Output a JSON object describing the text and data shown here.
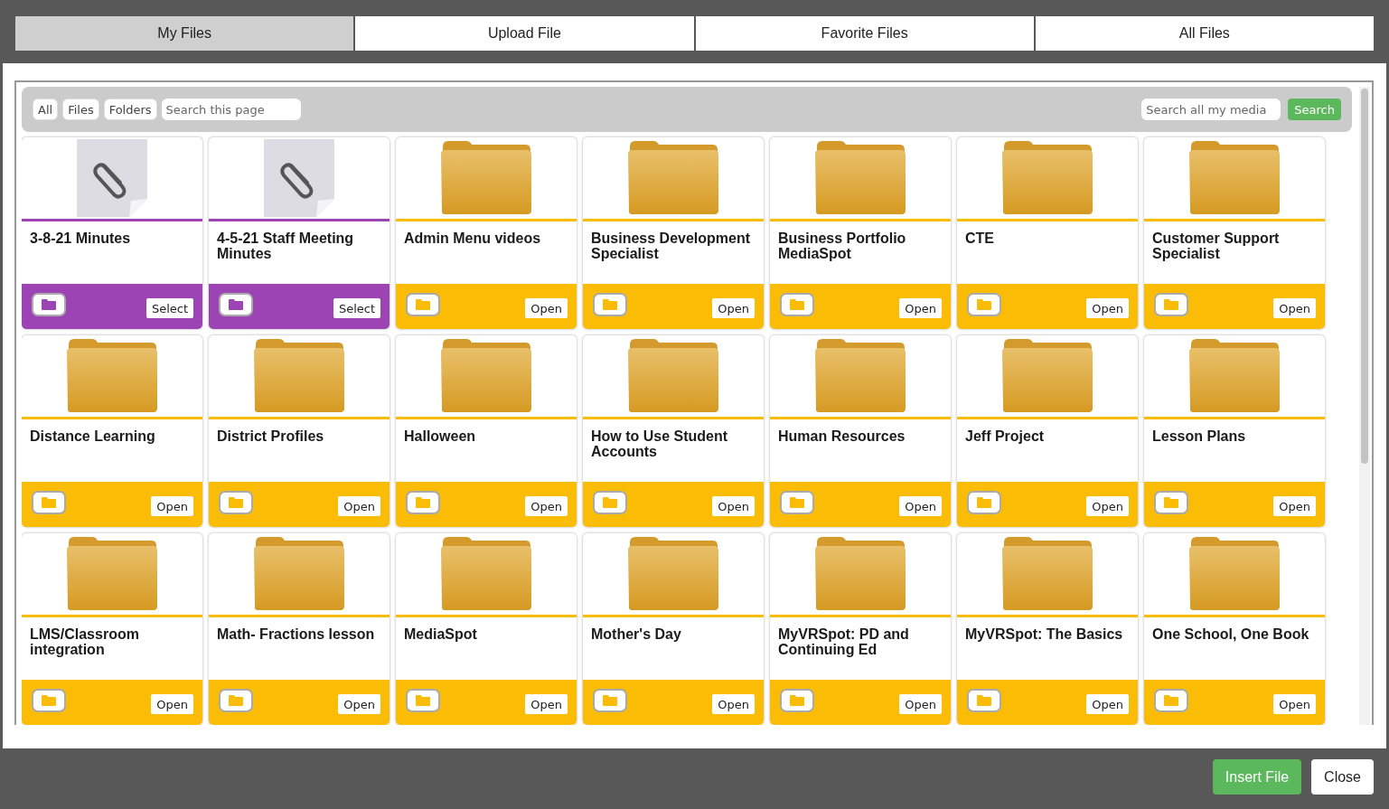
{
  "tabs": [
    {
      "label": "My Files",
      "selected": true
    },
    {
      "label": "Upload File",
      "selected": false
    },
    {
      "label": "Favorite Files",
      "selected": false
    },
    {
      "label": "All Files",
      "selected": false
    }
  ],
  "filters": [
    {
      "label": "All"
    },
    {
      "label": "Files"
    },
    {
      "label": "Folders"
    }
  ],
  "page_search": {
    "placeholder": "Search this page"
  },
  "media_search": {
    "placeholder": "Search all my media",
    "button": "Search"
  },
  "items": [
    {
      "kind": "file",
      "title": "3-8-21 Minutes",
      "action": "Select"
    },
    {
      "kind": "file",
      "title": "4-5-21 Staff Meeting Minutes",
      "action": "Select"
    },
    {
      "kind": "folder",
      "title": "Admin Menu videos",
      "action": "Open"
    },
    {
      "kind": "folder",
      "title": "Business Development Specialist",
      "action": "Open"
    },
    {
      "kind": "folder",
      "title": "Business Portfolio MediaSpot",
      "action": "Open"
    },
    {
      "kind": "folder",
      "title": "CTE",
      "action": "Open"
    },
    {
      "kind": "folder",
      "title": "Customer Support Specialist",
      "action": "Open"
    },
    {
      "kind": "folder",
      "title": "Distance Learning",
      "action": "Open"
    },
    {
      "kind": "folder",
      "title": "District Profiles",
      "action": "Open"
    },
    {
      "kind": "folder",
      "title": "Halloween",
      "action": "Open"
    },
    {
      "kind": "folder",
      "title": "How to Use Student Accounts",
      "action": "Open"
    },
    {
      "kind": "folder",
      "title": "Human Resources",
      "action": "Open"
    },
    {
      "kind": "folder",
      "title": "Jeff Project",
      "action": "Open"
    },
    {
      "kind": "folder",
      "title": "Lesson Plans",
      "action": "Open"
    },
    {
      "kind": "folder",
      "title": "LMS/Classroom integration",
      "action": "Open"
    },
    {
      "kind": "folder",
      "title": "Math- Fractions lesson",
      "action": "Open"
    },
    {
      "kind": "folder",
      "title": "MediaSpot",
      "action": "Open"
    },
    {
      "kind": "folder",
      "title": "Mother's Day",
      "action": "Open"
    },
    {
      "kind": "folder",
      "title": "MyVRSpot: PD and Continuing Ed",
      "action": "Open"
    },
    {
      "kind": "folder",
      "title": "MyVRSpot: The Basics",
      "action": "Open"
    },
    {
      "kind": "folder",
      "title": "One School, One Book",
      "action": "Open"
    }
  ],
  "footer": {
    "insert": "Insert File",
    "close": "Close"
  }
}
